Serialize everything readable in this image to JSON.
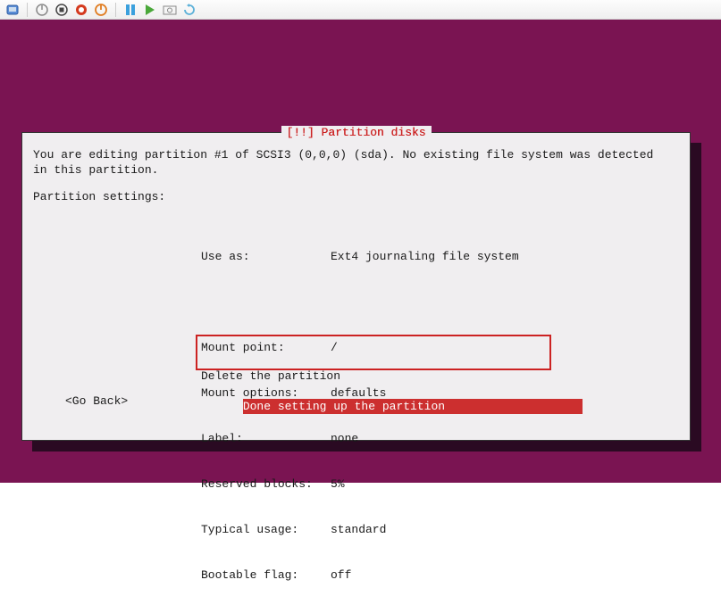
{
  "toolbar": {
    "icons": [
      "vm-icon",
      "power-off-icon",
      "stop-icon",
      "reset-icon",
      "power-icon",
      "pause-icon",
      "play-icon",
      "snapshot-icon",
      "revert-icon"
    ]
  },
  "dialog": {
    "title": "[!!] Partition disks",
    "description": "You are editing partition #1 of SCSI3 (0,0,0) (sda). No existing file system was detected\nin this partition.",
    "settings_label": "Partition settings:",
    "settings": [
      {
        "key": "Use as:",
        "value": "Ext4 journaling file system"
      },
      {
        "key": "",
        "value": ""
      },
      {
        "key": "Mount point:",
        "value": "/"
      },
      {
        "key": "Mount options:",
        "value": "defaults"
      },
      {
        "key": "Label:",
        "value": "none"
      },
      {
        "key": "Reserved blocks:",
        "value": "5%"
      },
      {
        "key": "Typical usage:",
        "value": "standard"
      },
      {
        "key": "Bootable flag:",
        "value": "off"
      }
    ],
    "actions": {
      "delete": "Delete the partition",
      "done": "Done setting up the partition"
    },
    "go_back": "<Go Back>"
  }
}
